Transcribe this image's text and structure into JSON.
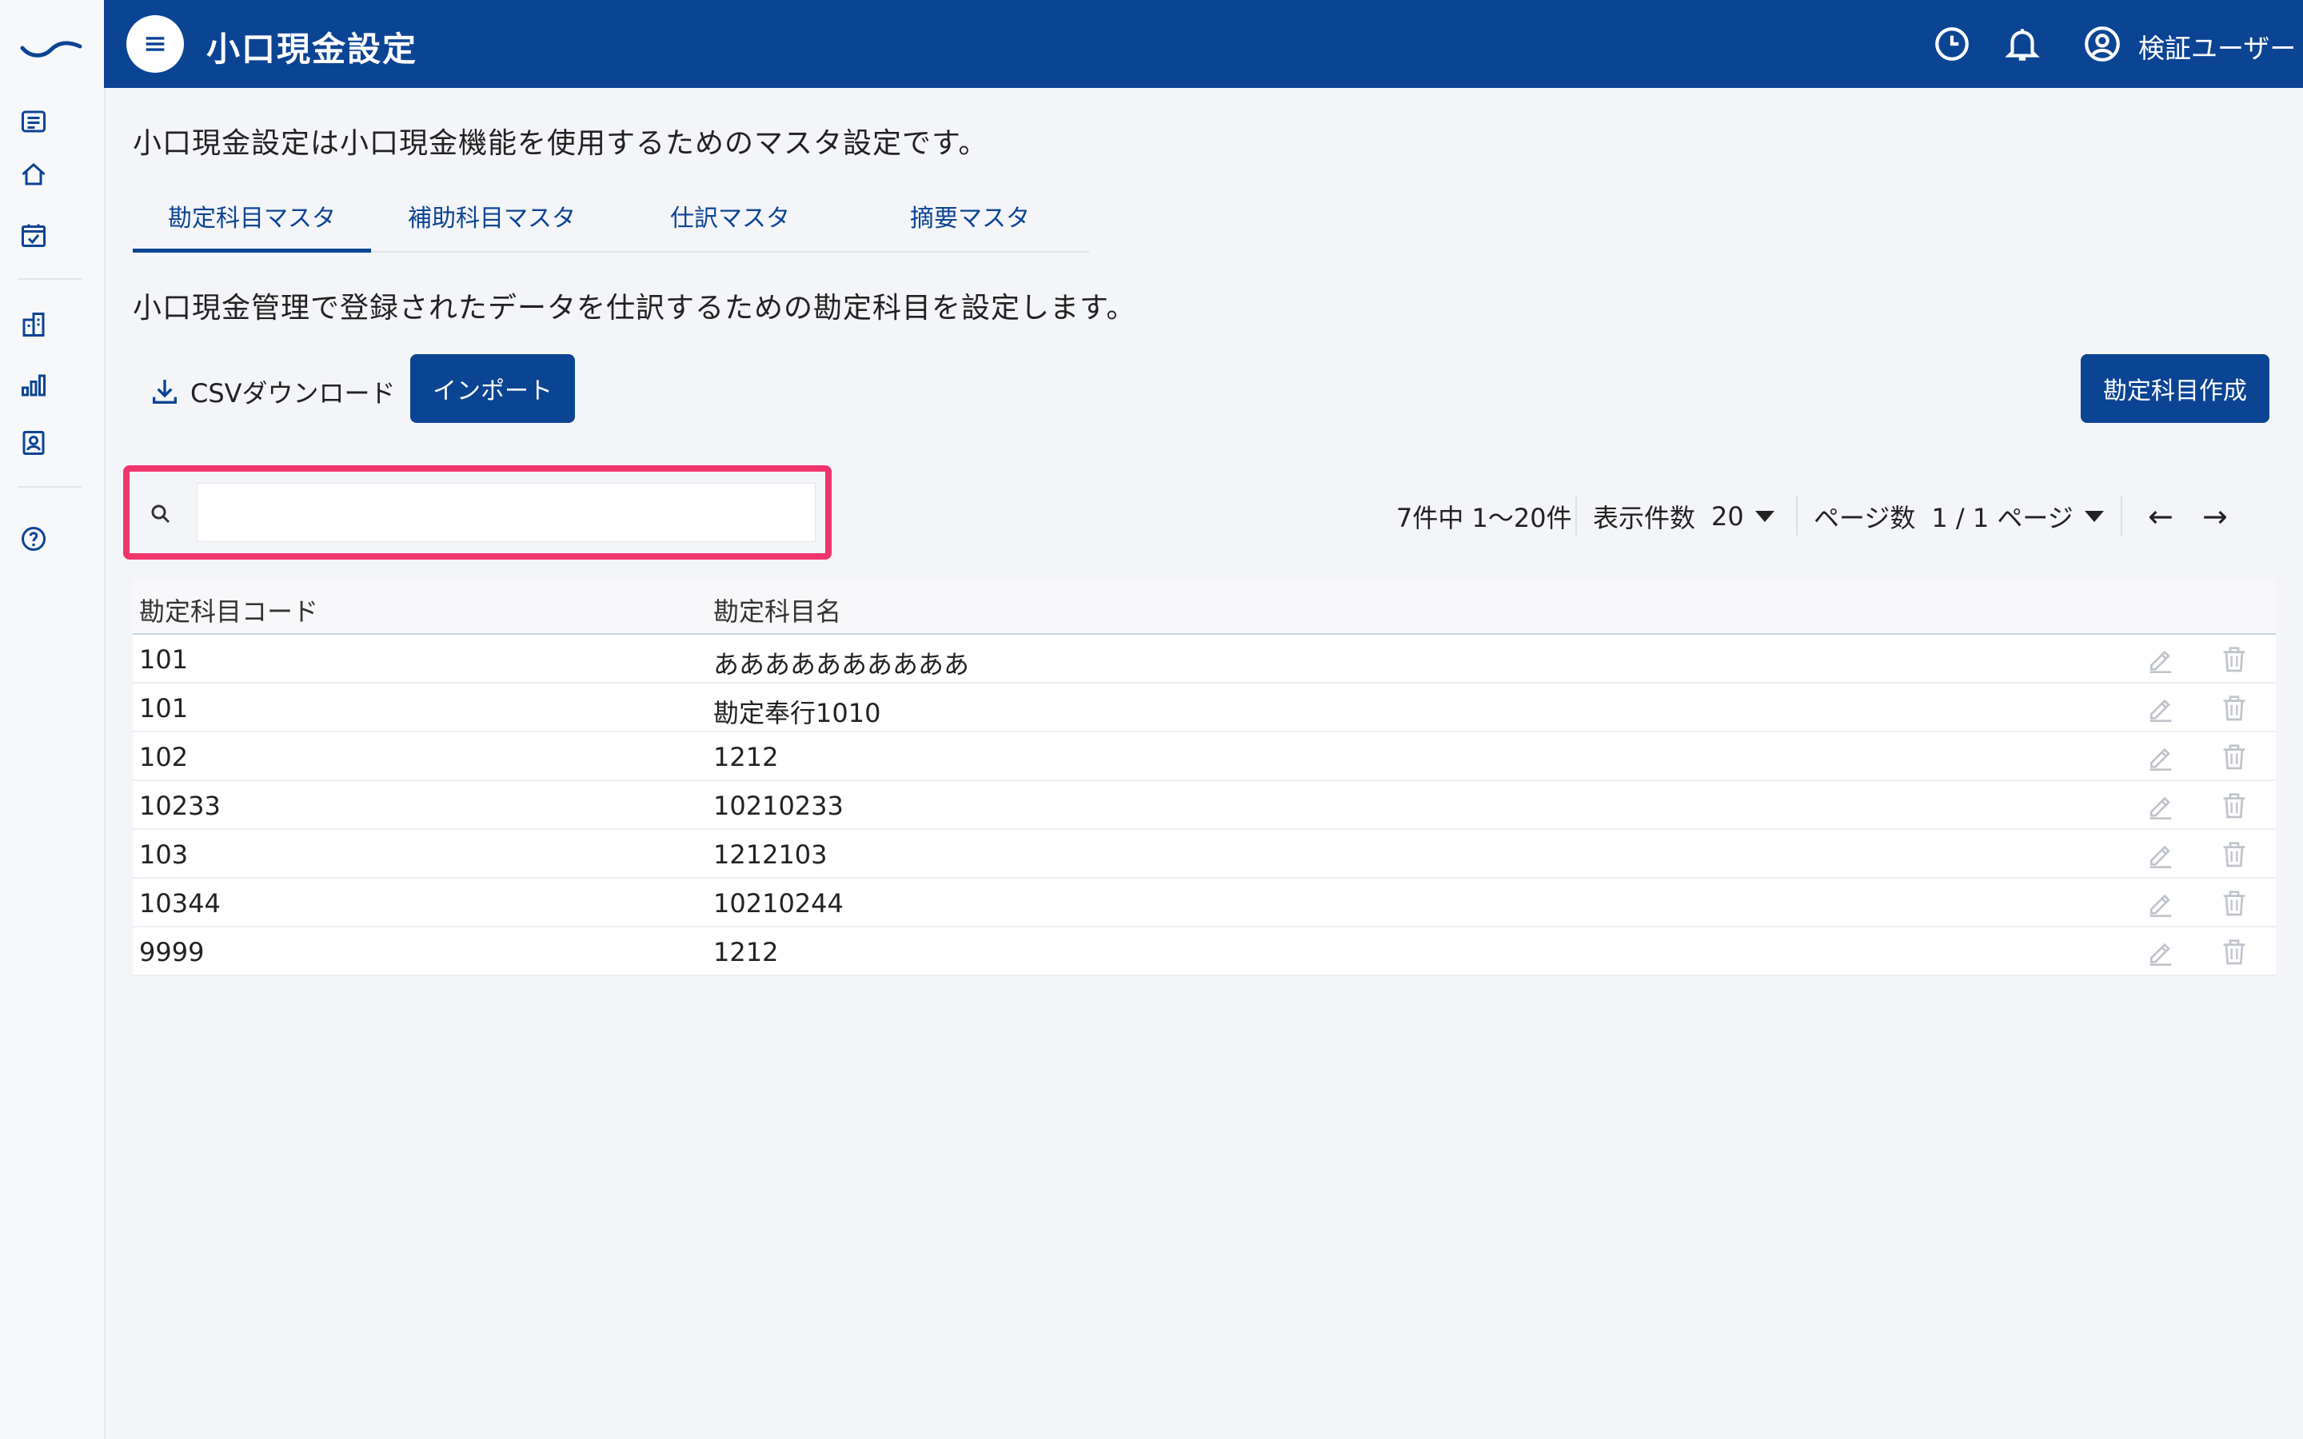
{
  "header": {
    "title": "小口現金設定",
    "user_name": "検証ユーザー",
    "icons": [
      "menu-icon",
      "history-clock-icon",
      "bell-icon",
      "user-circle-icon"
    ]
  },
  "rail": {
    "items": [
      "list-icon",
      "home-icon",
      "calendar-check-icon",
      "building-icon",
      "bar-chart-icon",
      "contact-card-icon",
      "help-icon"
    ]
  },
  "main": {
    "intro": "小口現金設定は小口現金機能を使用するためのマスタ設定です。",
    "tabs": [
      {
        "label": "勘定科目マスタ",
        "active": true
      },
      {
        "label": "補助科目マスタ",
        "active": false
      },
      {
        "label": "仕訳マスタ",
        "active": false
      },
      {
        "label": "摘要マスタ",
        "active": false
      }
    ],
    "sub_description": "小口現金管理で登録されたデータを仕訳するための勘定科目を設定します。",
    "csv_download_label": "CSVダウンロード",
    "import_label": "インポート",
    "create_label": "勘定科目作成",
    "search": {
      "value": "",
      "placeholder": ""
    }
  },
  "pager": {
    "range_text": "7件中 1〜20件",
    "per_page_label": "表示件数",
    "per_page_value": "20",
    "page_label": "ページ数",
    "page_value": "1 / 1 ページ",
    "prev": "←",
    "next": "→"
  },
  "table": {
    "columns": [
      "勘定科目コード",
      "勘定科目名"
    ],
    "rows": [
      [
        "101",
        "ああああああああああ"
      ],
      [
        "101",
        "勘定奉行1010"
      ],
      [
        "102",
        "1212"
      ],
      [
        "10233",
        "10210233"
      ],
      [
        "103",
        "1212103"
      ],
      [
        "10344",
        "10210244"
      ],
      [
        "9999",
        "1212"
      ]
    ]
  },
  "colors": {
    "brand": "#0c4494",
    "highlight": "#f0356d",
    "background": "#f4f5f8"
  }
}
